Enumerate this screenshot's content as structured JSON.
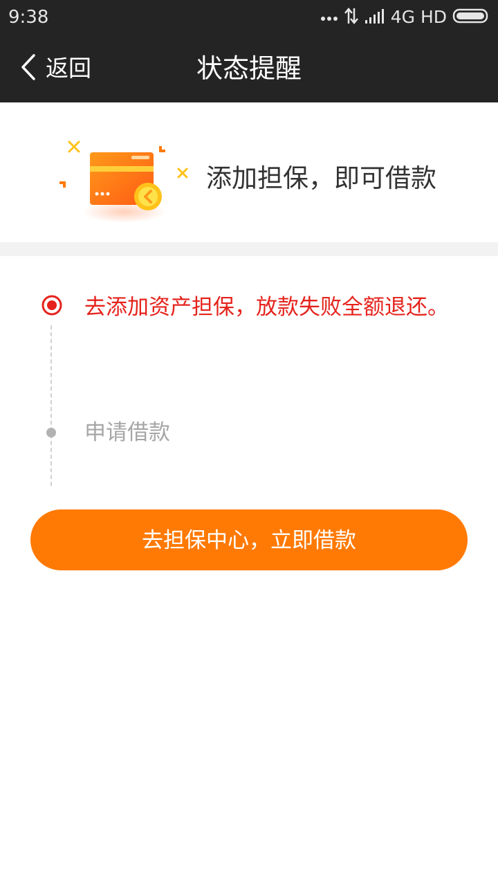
{
  "status_bar": {
    "time": "9:38",
    "network": "4G HD",
    "icons": [
      "more-dots-icon",
      "data-transfer-icon",
      "signal-icon",
      "battery-icon"
    ]
  },
  "nav": {
    "back_label": "返回",
    "title": "状态提醒"
  },
  "banner": {
    "text": "添加担保，即可借款",
    "icon": "card-coin-illustration-icon"
  },
  "timeline": {
    "steps": [
      {
        "label": "去添加资产担保，放款失败全额退还。",
        "state": "current"
      },
      {
        "label": "申请借款",
        "state": "pending"
      }
    ]
  },
  "cta": {
    "label": "去担保中心，立即借款"
  },
  "colors": {
    "header_bg": "#242424",
    "accent_orange": "#ff7a05",
    "alert_red": "#e5231c",
    "pending_gray": "#a6a6a6",
    "divider_gray": "#f2f2f2"
  }
}
